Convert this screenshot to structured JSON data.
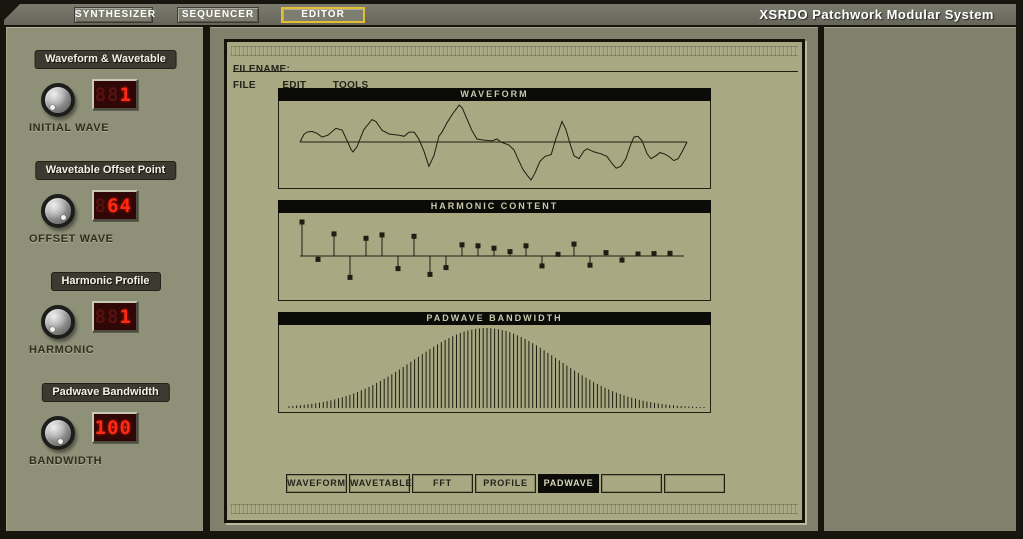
{
  "window": {
    "title": "XSRDO Patchwork Modular System"
  },
  "topbar": {
    "buttons": [
      {
        "label": "SYNTHESIZER",
        "active": false
      },
      {
        "label": "SEQUENCER",
        "active": false
      },
      {
        "label": "EDITOR",
        "active": true
      }
    ]
  },
  "sidebar": {
    "sections": [
      {
        "badge": "Waveform & Wavetable",
        "knob_label": "INITIAL WAVE",
        "led_ghost": "88",
        "led_value": "1",
        "indicator_angle": 215
      },
      {
        "badge": "Wavetable Offset Point",
        "knob_label": "OFFSET WAVE",
        "led_ghost": "8",
        "led_value": "64",
        "indicator_angle": 142
      },
      {
        "badge": "Harmonic Profile",
        "knob_label": "HARMONIC",
        "led_ghost": "88",
        "led_value": "1",
        "indicator_angle": 215
      },
      {
        "badge": "Padwave Bandwidth",
        "knob_label": "BANDWIDTH",
        "led_ghost": "",
        "led_value": "100",
        "indicator_angle": 160
      }
    ]
  },
  "editor": {
    "filename_label": "FILENAME:",
    "filename_value": "",
    "menu": [
      "FILE",
      "EDIT",
      "TOOLS"
    ],
    "tabs": [
      {
        "label": "WAVEFORM",
        "active": false
      },
      {
        "label": "WAVETABLE",
        "active": false
      },
      {
        "label": "FFT",
        "active": false
      },
      {
        "label": "PROFILE",
        "active": false
      },
      {
        "label": "PADWAVE",
        "active": true
      },
      {
        "label": "",
        "active": false
      },
      {
        "label": "",
        "active": false
      }
    ]
  },
  "chart_data": [
    {
      "type": "line",
      "title": "WAVEFORM",
      "xlabel": "",
      "ylabel": "",
      "x": [
        0,
        1,
        1.8,
        3.1,
        4.4,
        5.7,
        7.2,
        9.3,
        10.9,
        12.1,
        13.2,
        13.7,
        14.7,
        16.5,
        18.6,
        19.6,
        21.2,
        23,
        25.6,
        26.9,
        28.2,
        29.5,
        30.7,
        32,
        33.3,
        34.6,
        35.9,
        36.7,
        38,
        39.3,
        41.1,
        41.9,
        43.2,
        44.4,
        45.7,
        47.5,
        49.6,
        50.9,
        51.9,
        52.7,
        54,
        55.3,
        56.3,
        57.6,
        58.9,
        59.7,
        60.7,
        62,
        63.3,
        64.9,
        66.1,
        67.7,
        68.7,
        69.8,
        70.8,
        72.1,
        73.4,
        74.2,
        76,
        77.8,
        79.3,
        80.6,
        81.7,
        82.9,
        84.2,
        85.5,
        86.3,
        87.3,
        88.4,
        89.7,
        90.7,
        92,
        93,
        94.1,
        95.3,
        96.6,
        97.7,
        98.7,
        100
      ],
      "y": [
        0,
        0.2,
        0.26,
        0.28,
        0.23,
        0.13,
        0.18,
        0.36,
        0.31,
        0.05,
        -0.2,
        -0.26,
        -0.13,
        0.33,
        0.59,
        0.54,
        0.31,
        0.21,
        0.18,
        0.15,
        0.26,
        0.26,
        0.08,
        -0.23,
        -0.64,
        -0.36,
        0.15,
        0.26,
        0.51,
        0.72,
        0.97,
        0.9,
        0.59,
        0.31,
        0.08,
        0.05,
        0.03,
        0.08,
        0,
        -0.03,
        -0.08,
        -0.21,
        -0.44,
        -0.72,
        -0.9,
        -1,
        -0.82,
        -0.51,
        -0.38,
        -0.33,
        0.08,
        0.54,
        0.33,
        -0.05,
        -0.36,
        -0.44,
        -0.23,
        -0.18,
        -0.26,
        -0.31,
        -0.38,
        -0.56,
        -0.69,
        -0.64,
        -0.44,
        -0.05,
        0.13,
        0.15,
        0.03,
        -0.31,
        -0.44,
        -0.36,
        -0.28,
        -0.31,
        -0.38,
        -0.49,
        -0.44,
        -0.26,
        0
      ],
      "xlim": [
        0,
        100
      ],
      "ylim": [
        -1.15,
        1.15
      ],
      "zero_line": true,
      "grid": false,
      "legend": false
    },
    {
      "type": "stem",
      "title": "HARMONIC CONTENT",
      "marker": "square",
      "harmonic_index": [
        1,
        2,
        3,
        4,
        5,
        6,
        7,
        8,
        9,
        10,
        11,
        12,
        13,
        14,
        15,
        16,
        17,
        18,
        19,
        20,
        21,
        22,
        23,
        24
      ],
      "values": [
        1.0,
        -0.1,
        0.65,
        -0.63,
        0.52,
        0.62,
        -0.37,
        0.58,
        -0.54,
        -0.34,
        0.33,
        0.3,
        0.23,
        0.13,
        0.3,
        -0.29,
        0.05,
        0.35,
        -0.27,
        0.1,
        -0.12,
        0.06,
        0.07,
        0.08
      ],
      "ylim": [
        -1,
        1
      ],
      "grid": false,
      "legend": false
    },
    {
      "type": "bars",
      "title": "PADWAVE BANDWIDTH",
      "envelope": "gaussian",
      "num_bars": 110,
      "peak_position": 0.475,
      "sigma": 0.173,
      "peak_height": 80,
      "min_height": 1,
      "grid": false,
      "legend": false
    }
  ],
  "colors": {
    "body_bg": "#16160f",
    "topbar_bg": "#6e6e62",
    "left_panel_bg": "#8e9078",
    "mid_panel_bg": "#7f816c",
    "editor_bg": "#a8a882",
    "accent_editor_button": "#e2be34",
    "led_bg": "#300707",
    "led_lit": "#ff2a12",
    "led_ghost": "#571111",
    "chart_ink": "#1e1e12",
    "panel_title_bg": "#0b0b07"
  }
}
